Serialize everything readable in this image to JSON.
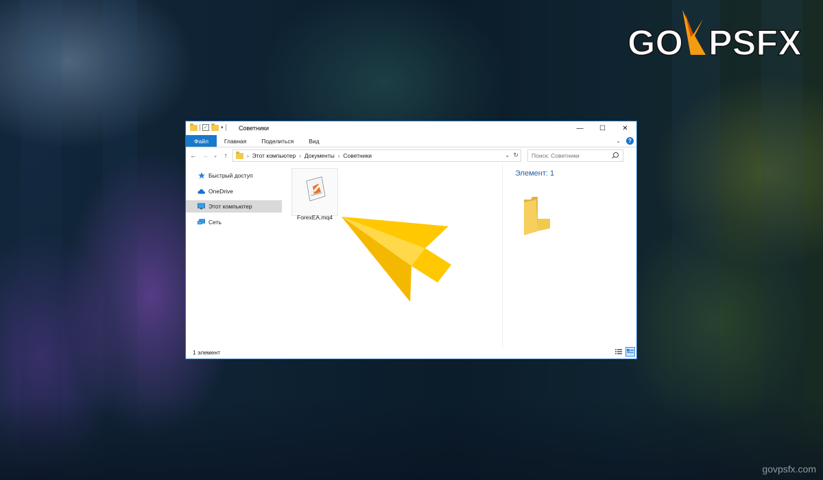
{
  "logo": {
    "text_go": "GO",
    "text_v": "V",
    "text_psfx": "PSFX"
  },
  "watermark": "govpsfx.com",
  "window": {
    "title": "Советники",
    "controls": {
      "minimize": "—",
      "maximize": "☐",
      "close": "✕"
    },
    "ribbon_tabs": [
      "Файл",
      "Главная",
      "Поделиться",
      "Вид"
    ],
    "nav": {
      "back": "←",
      "forward": "→",
      "recent": "⌄",
      "up": "↑"
    },
    "address": {
      "crumbs": [
        "Этот компьютер",
        "Документы",
        "Советники"
      ],
      "separator": "›",
      "dropdown": "⌄",
      "refresh": "↻"
    },
    "search": {
      "placeholder": "Поиск: Советники"
    },
    "sidebar": [
      {
        "label": "Быстрый доступ",
        "icon": "star-icon"
      },
      {
        "label": "OneDrive",
        "icon": "cloud-icon"
      },
      {
        "label": "Этот компьютер",
        "icon": "computer-icon",
        "selected": true
      },
      {
        "label": "Сеть",
        "icon": "network-icon"
      }
    ],
    "files": [
      {
        "name": "ForexEA.mq4",
        "icon": "mq4-file-icon"
      }
    ],
    "preview": {
      "title": "Элемент: 1"
    },
    "status": "1 элемент"
  },
  "colors": {
    "accent": "#1979ca",
    "folder": "#f2c94c",
    "pointer": "#ffc800"
  }
}
